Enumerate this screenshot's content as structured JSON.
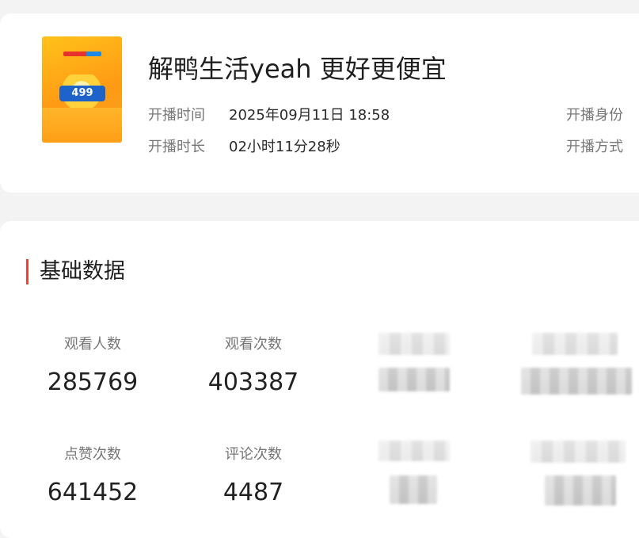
{
  "live": {
    "title": "解鸭生活yeah 更好更便宜",
    "cover": {
      "price_text": "499",
      "brand_color": "#e5322d",
      "bg_color": "#ffb300"
    },
    "meta": {
      "start_time_label": "开播时间",
      "start_time_value": "2025年09月11日 18:58",
      "duration_label": "开播时长",
      "duration_value": "02小时11分28秒",
      "identity_label": "开播身份",
      "mode_label": "开播方式"
    }
  },
  "basic_data": {
    "section_title": "基础数据",
    "accent_color": "#e8453c",
    "stats": [
      {
        "label": "观看人数",
        "value": "285769"
      },
      {
        "label": "观看次数",
        "value": "403387"
      },
      {
        "label": "点赞次数",
        "value": "641452"
      },
      {
        "label": "评论次数",
        "value": "4487"
      }
    ]
  }
}
